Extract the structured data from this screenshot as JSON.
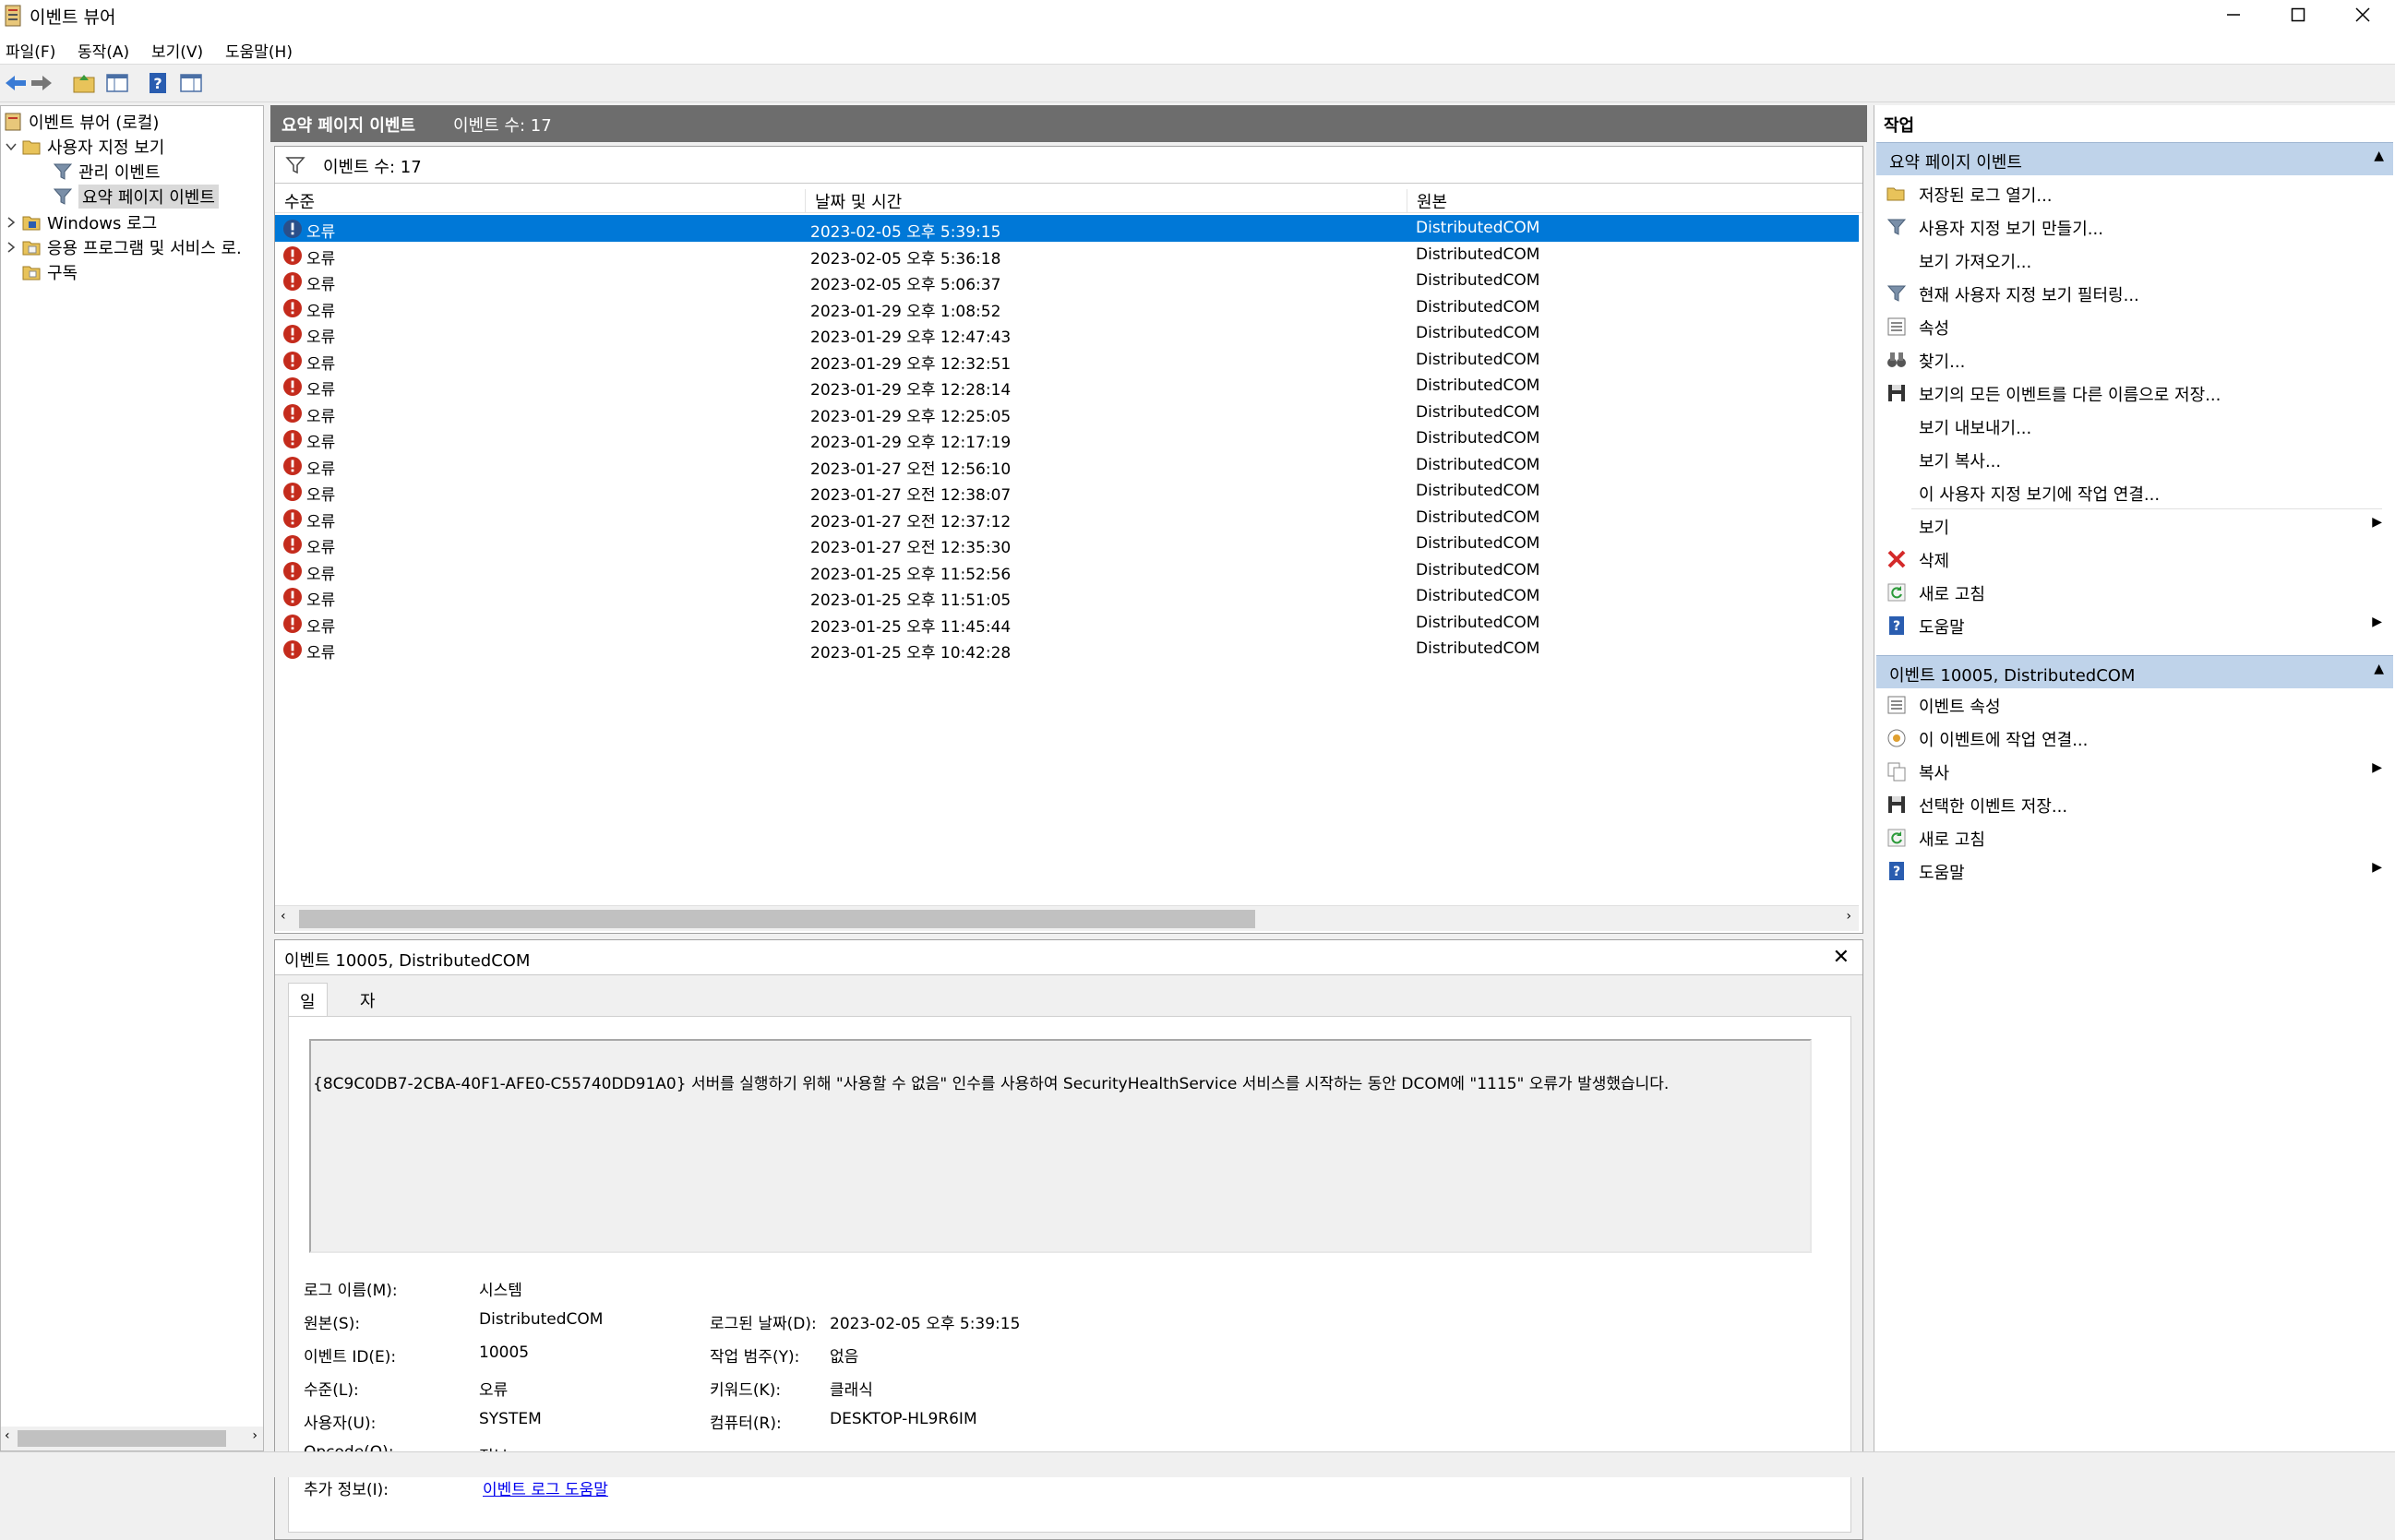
{
  "window": {
    "title": "이벤트 뷰어"
  },
  "menu": [
    "파일(F)",
    "동작(A)",
    "보기(V)",
    "도움말(H)"
  ],
  "tree": {
    "root": "이벤트 뷰어 (로컬)",
    "custom_views": "사용자 지정 보기",
    "admin_events": "관리 이벤트",
    "summary_events": "요약 페이지 이벤트",
    "windows_logs": "Windows 로그",
    "app_service_logs": "응용 프로그램 및 서비스 로.",
    "subscriptions": "구독"
  },
  "center": {
    "header_title": "요약 페이지 이벤트",
    "header_count": "이벤트 수: 17",
    "filter_text": "이벤트 수: 17",
    "columns": [
      "수준",
      "날짜 및 시간",
      "원본"
    ],
    "events": [
      {
        "level": "오류",
        "datetime": "2023-02-05 오후 5:39:15",
        "source": "DistributedCOM"
      },
      {
        "level": "오류",
        "datetime": "2023-02-05 오후 5:36:18",
        "source": "DistributedCOM"
      },
      {
        "level": "오류",
        "datetime": "2023-02-05 오후 5:06:37",
        "source": "DistributedCOM"
      },
      {
        "level": "오류",
        "datetime": "2023-01-29 오후 1:08:52",
        "source": "DistributedCOM"
      },
      {
        "level": "오류",
        "datetime": "2023-01-29 오후 12:47:43",
        "source": "DistributedCOM"
      },
      {
        "level": "오류",
        "datetime": "2023-01-29 오후 12:32:51",
        "source": "DistributedCOM"
      },
      {
        "level": "오류",
        "datetime": "2023-01-29 오후 12:28:14",
        "source": "DistributedCOM"
      },
      {
        "level": "오류",
        "datetime": "2023-01-29 오후 12:25:05",
        "source": "DistributedCOM"
      },
      {
        "level": "오류",
        "datetime": "2023-01-29 오후 12:17:19",
        "source": "DistributedCOM"
      },
      {
        "level": "오류",
        "datetime": "2023-01-27 오전 12:56:10",
        "source": "DistributedCOM"
      },
      {
        "level": "오류",
        "datetime": "2023-01-27 오전 12:38:07",
        "source": "DistributedCOM"
      },
      {
        "level": "오류",
        "datetime": "2023-01-27 오전 12:37:12",
        "source": "DistributedCOM"
      },
      {
        "level": "오류",
        "datetime": "2023-01-27 오전 12:35:30",
        "source": "DistributedCOM"
      },
      {
        "level": "오류",
        "datetime": "2023-01-25 오후 11:52:56",
        "source": "DistributedCOM"
      },
      {
        "level": "오류",
        "datetime": "2023-01-25 오후 11:51:05",
        "source": "DistributedCOM"
      },
      {
        "level": "오류",
        "datetime": "2023-01-25 오후 11:45:44",
        "source": "DistributedCOM"
      },
      {
        "level": "오류",
        "datetime": "2023-01-25 오후 10:42:28",
        "source": "DistributedCOM"
      }
    ],
    "selected_index": 0
  },
  "detail": {
    "title": "이벤트 10005, DistributedCOM",
    "tabs": [
      "일반",
      "자세히"
    ],
    "message": "{8C9C0DB7-2CBA-40F1-AFE0-C55740DD91A0} 서버를 실행하기 위해 \"사용할 수 없음\" 인수를 사용하여 SecurityHealthService 서비스를 시작하는 동안 DCOM에 \"1115\" 오류가 발생했습니다.",
    "labels": {
      "log_name": "로그 이름(M):",
      "source": "원본(S):",
      "event_id": "이벤트 ID(E):",
      "level": "수준(L):",
      "user": "사용자(U):",
      "opcode": "Opcode(O):",
      "more_info": "추가 정보(I):",
      "logged": "로그된 날짜(D):",
      "task_category": "작업 범주(Y):",
      "keywords": "키워드(K):",
      "computer": "컴퓨터(R):"
    },
    "values": {
      "log_name": "시스템",
      "source": "DistributedCOM",
      "event_id": "10005",
      "level": "오류",
      "user": "SYSTEM",
      "opcode": "정보",
      "more_info": "이벤트 로그 도움말",
      "logged": "2023-02-05 오후 5:39:15",
      "task_category": "없음",
      "keywords": "클래식",
      "computer": "DESKTOP-HL9R6IM"
    }
  },
  "actions": {
    "title": "작업",
    "section1": {
      "title": "요약 페이지 이벤트",
      "items": [
        {
          "label": "저장된 로그 열기...",
          "icon": "open-folder-icon"
        },
        {
          "label": "사용자 지정 보기 만들기...",
          "icon": "filter-icon"
        },
        {
          "label": "보기 가져오기...",
          "icon": ""
        },
        {
          "label": "현재 사용자 지정 보기 필터링...",
          "icon": "filter-icon"
        },
        {
          "label": "속성",
          "icon": "properties-icon"
        },
        {
          "label": "찾기...",
          "icon": "binoculars-icon"
        },
        {
          "label": "보기의 모든 이벤트를 다른 이름으로 저장...",
          "icon": "save-icon"
        },
        {
          "label": "보기 내보내기...",
          "icon": ""
        },
        {
          "label": "보기 복사...",
          "icon": ""
        },
        {
          "label": "이 사용자 지정 보기에 작업 연결...",
          "icon": ""
        },
        {
          "label": "보기",
          "icon": ""
        },
        {
          "label": "삭제",
          "icon": "delete-icon"
        },
        {
          "label": "새로 고침",
          "icon": "refresh-icon"
        },
        {
          "label": "도움말",
          "icon": "help-icon"
        }
      ]
    },
    "section2": {
      "title": "이벤트 10005, DistributedCOM",
      "items": [
        {
          "label": "이벤트 속성",
          "icon": "properties-icon"
        },
        {
          "label": "이 이벤트에 작업 연결...",
          "icon": "task-icon"
        },
        {
          "label": "복사",
          "icon": "copy-icon"
        },
        {
          "label": "선택한 이벤트 저장...",
          "icon": "save-icon"
        },
        {
          "label": "새로 고침",
          "icon": "refresh-icon"
        },
        {
          "label": "도움말",
          "icon": "help-icon"
        }
      ]
    }
  },
  "colors": {
    "selection": "#0078d7",
    "error": "#c42b1c",
    "section_header": "#bfd3ea",
    "link": "#0000ee"
  }
}
